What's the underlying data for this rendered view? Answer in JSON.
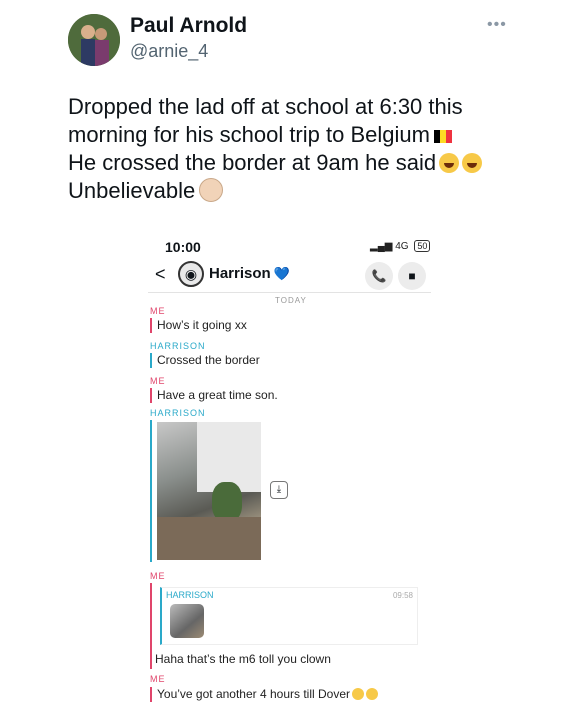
{
  "author": {
    "name": "Paul Arnold",
    "handle": "@arnie_4",
    "more": "•••"
  },
  "tweet": {
    "line1": "Dropped the lad off at school at 6:30 this",
    "line2": "morning for his school trip to Belgium",
    "line3": "He crossed the border at 9am he said",
    "line4": "Unbelievable",
    "flag_colors": [
      "#000000",
      "#fdda24",
      "#ef3340"
    ]
  },
  "screenshot": {
    "time": "10:00",
    "network": "4G",
    "battery": "50",
    "back": "<",
    "contact": "Harrison",
    "heart": "💙",
    "call_icon": "📞",
    "video_icon": "■",
    "today": "TODAY",
    "messages": [
      {
        "sender": "ME",
        "text": "How’s it going xx"
      },
      {
        "sender": "HARRISON",
        "text": "Crossed the border"
      },
      {
        "sender": "ME",
        "text": "Have a great time son."
      },
      {
        "sender": "HARRISON",
        "text": ""
      },
      {
        "sender": "ME",
        "text": "Haha that’s the m6 toll you clown"
      },
      {
        "sender": "ME",
        "text": "You’ve got another 4 hours till Dover"
      }
    ],
    "quote": {
      "sender": "HARRISON",
      "time": "09:58"
    },
    "save_icon": "⤓"
  }
}
